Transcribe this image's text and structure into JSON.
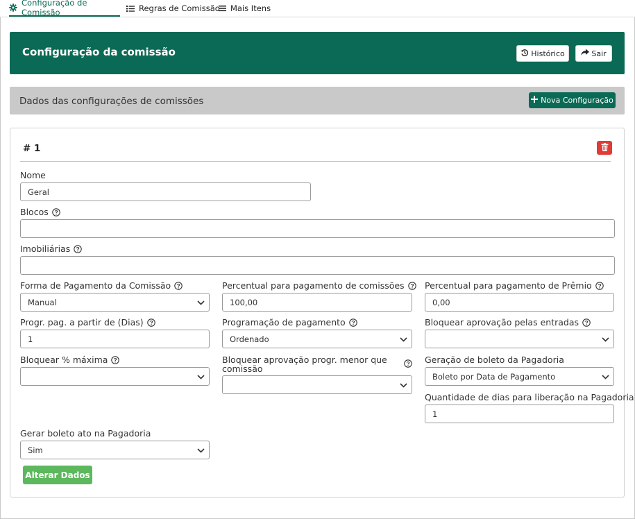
{
  "tabs": [
    {
      "label": "Configuração de Comissão",
      "icon": "gear-icon"
    },
    {
      "label": "Regras de Comissão",
      "icon": "list-icon"
    },
    {
      "label": "Mais Itens",
      "icon": "menu-icon"
    }
  ],
  "header": {
    "title": "Configuração da comissão",
    "history_label": "Histórico",
    "exit_label": "Sair"
  },
  "section": {
    "title": "Dados das configurações de comissões",
    "new_label": "Nova Configuração"
  },
  "card": {
    "number": "# 1"
  },
  "form": {
    "nome": {
      "label": "Nome",
      "value": "Geral"
    },
    "blocos": {
      "label": "Blocos",
      "value": ""
    },
    "imobiliarias": {
      "label": "Imobiliárias",
      "value": ""
    },
    "forma_pagamento": {
      "label": "Forma de Pagamento da Comissão",
      "value": "Manual"
    },
    "percentual_comissoes": {
      "label": "Percentual para pagamento de comissões",
      "value": "100,00"
    },
    "percentual_premio": {
      "label": "Percentual para pagamento de Prêmio",
      "value": "0,00"
    },
    "progr_pag": {
      "label": "Progr. pag. a partir de (Dias)",
      "value": "1"
    },
    "programacao_pagamento": {
      "label": "Programação de pagamento",
      "value": "Ordenado"
    },
    "bloquear_aprovacao_entradas": {
      "label": "Bloquear aprovação pelas entradas",
      "value": ""
    },
    "bloquear_maxima": {
      "label": "Bloquear % máxima",
      "value": ""
    },
    "bloquear_aprovacao_progr": {
      "label_line1": "Bloquear aprovação progr. menor que",
      "label_line2": "comissão",
      "value": ""
    },
    "geracao_boleto": {
      "label": "Geração de boleto da Pagadoria",
      "value": "Boleto por Data de Pagamento"
    },
    "quantidade_dias": {
      "label": "Quantidade de dias para liberação na Pagadoria",
      "value": "1"
    },
    "gerar_boleto_ato": {
      "label": "Gerar boleto ato na Pagadoria",
      "value": "Sim"
    },
    "submit_label": "Alterar Dados"
  },
  "colors": {
    "primary": "#0b6a55",
    "success": "#5cb85c",
    "danger": "#e03b36",
    "section_bg": "#c9c9c9"
  }
}
